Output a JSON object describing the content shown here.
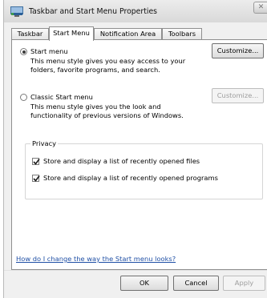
{
  "window": {
    "title": "Taskbar and Start Menu Properties",
    "close_glyph": "✕",
    "app_icon": "taskbar-icon"
  },
  "tabs": [
    {
      "label": "Taskbar"
    },
    {
      "label": "Start Menu"
    },
    {
      "label": "Notification Area"
    },
    {
      "label": "Toolbars"
    }
  ],
  "start_menu": {
    "option_label": "Start menu",
    "option_desc_1": "This menu style gives you easy access to your",
    "option_desc_2": "folders, favorite programs, and search.",
    "customize_label": "Customize..."
  },
  "classic_menu": {
    "option_label": "Classic Start menu",
    "option_desc_1": "This menu style gives you the look and",
    "option_desc_2": "functionality of previous versions of Windows.",
    "customize_label": "Customize..."
  },
  "privacy": {
    "legend": "Privacy",
    "files_label": "Store and display a list of recently opened files",
    "programs_label": "Store and display a list of recently opened programs"
  },
  "help_link": "How do I change the way the Start menu looks?",
  "buttons": {
    "ok": "OK",
    "cancel": "Cancel",
    "apply": "Apply"
  }
}
